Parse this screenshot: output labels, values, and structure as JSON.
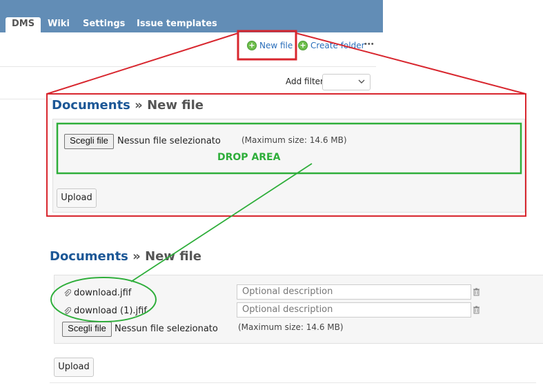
{
  "tabs": [
    {
      "label": "DMS",
      "selected": true
    },
    {
      "label": "Wiki",
      "selected": false
    },
    {
      "label": "Settings",
      "selected": false
    },
    {
      "label": "Issue templates",
      "selected": false
    }
  ],
  "toolbar": {
    "new_file": "New file",
    "create_folder": "Create folder",
    "more": "•••"
  },
  "filter": {
    "label": "Add filter"
  },
  "form1": {
    "crumb": "Documents",
    "separator": " » ",
    "title": "New file",
    "choose_button": "Scegli file",
    "no_file": "Nessun file selezionato",
    "max_size": "(Maximum size: 14.6 MB)",
    "drop_label": "DROP AREA",
    "upload": "Upload"
  },
  "form2": {
    "crumb": "Documents",
    "separator": " » ",
    "title": "New file",
    "files": [
      {
        "name": "download.jfif",
        "placeholder": "Optional description"
      },
      {
        "name": "download (1).jfif",
        "placeholder": "Optional description"
      }
    ],
    "choose_button": "Scegli file",
    "no_file": "Nessun file selezionato",
    "max_size": "(Maximum size: 14.6 MB)",
    "upload": "Upload"
  },
  "colors": {
    "tab_bar": "#628db6",
    "link": "#1c5796",
    "annotation_red": "#d8262e",
    "annotation_green": "#2eae3a"
  }
}
